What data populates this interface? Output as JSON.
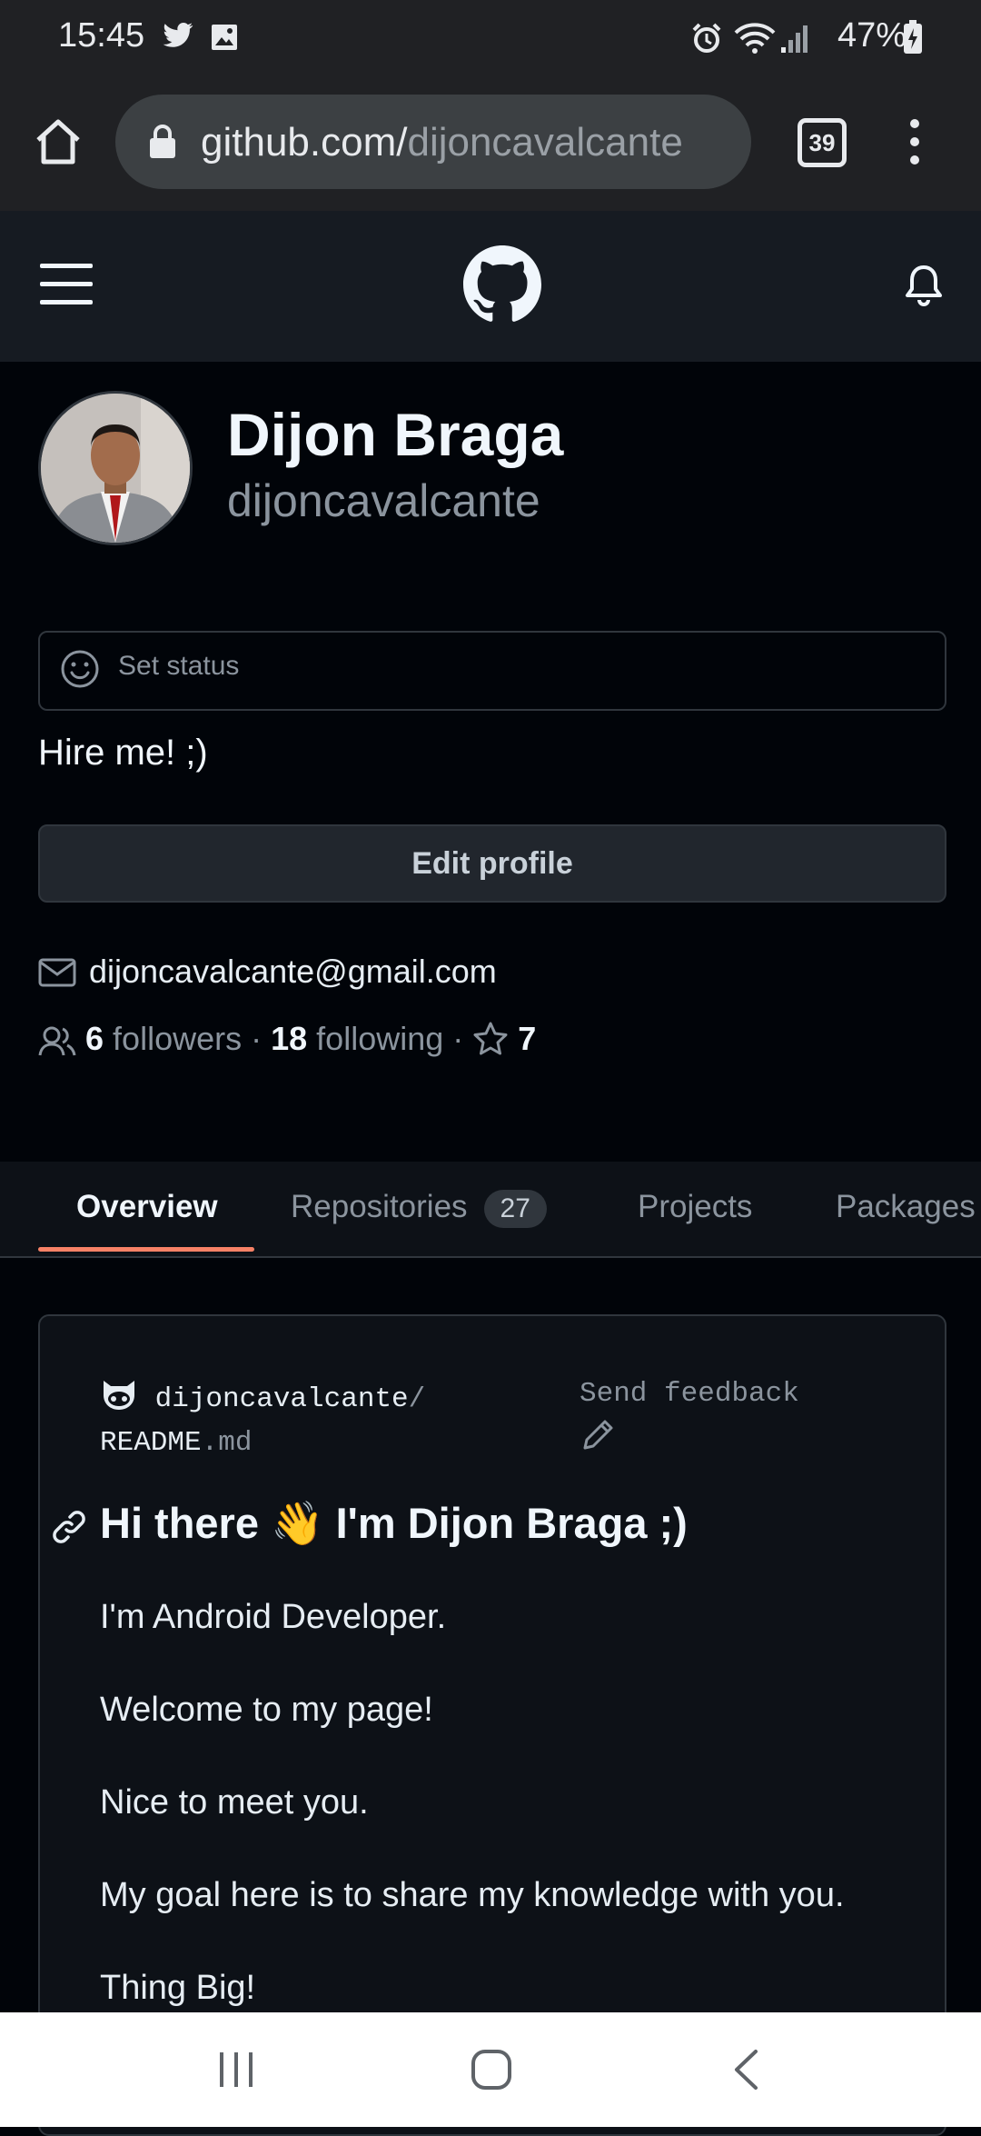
{
  "status_bar": {
    "time": "15:45",
    "battery": "47%"
  },
  "browser": {
    "url_host": "github.com/",
    "url_path": "dijoncavalcante",
    "tab_count": "39"
  },
  "profile": {
    "name": "Dijon Braga",
    "login": "dijoncavalcante",
    "set_status": "Set status",
    "bio": "Hire me! ;)",
    "edit_profile": "Edit profile",
    "email": "dijoncavalcante@gmail.com",
    "followers_count": "6",
    "followers_label": "followers",
    "following_count": "18",
    "following_label": "following",
    "stars": "7"
  },
  "tabs": {
    "overview": "Overview",
    "repositories": "Repositories",
    "repositories_count": "27",
    "projects": "Projects",
    "packages": "Packages"
  },
  "readme": {
    "owner": "dijoncavalcante",
    "sep": "/",
    "file": "README",
    "ext": ".md",
    "feedback": "Send feedback",
    "heading": "Hi there 👋 I'm Dijon Braga ;)",
    "lines": [
      "I'm Android Developer.",
      "Welcome to my page!",
      "Nice to meet you.",
      "My goal here is to share my knowledge with you.",
      "Thing Big!"
    ]
  },
  "colors": {
    "accent_underline": "#f78166",
    "bg": "#010409",
    "header": "#161b22"
  }
}
